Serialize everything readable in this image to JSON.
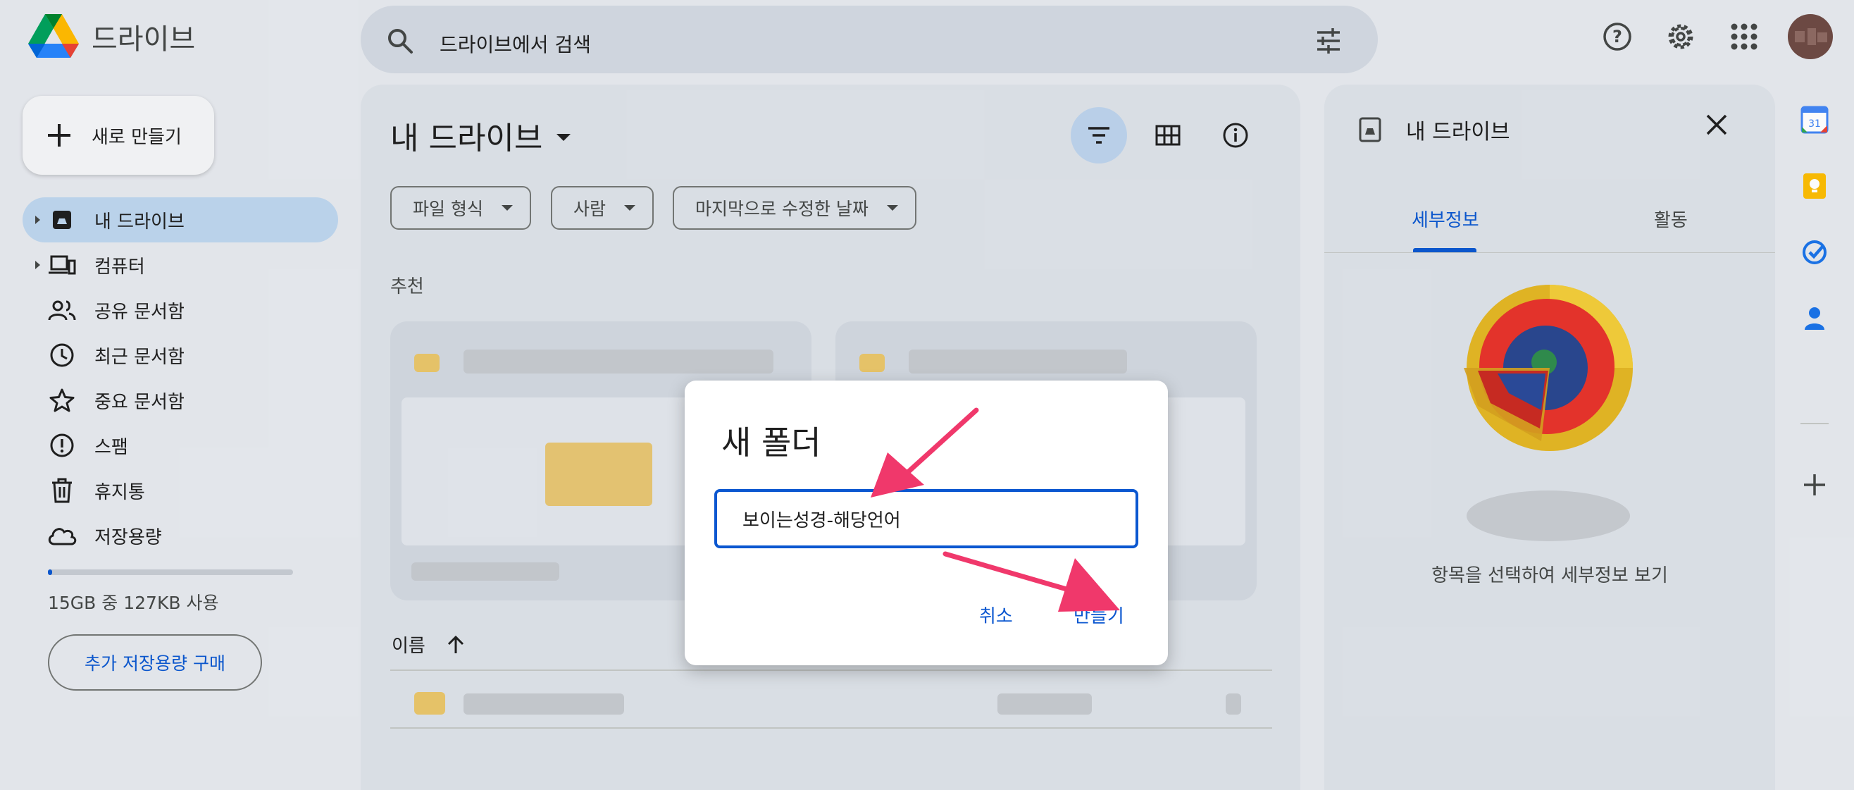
{
  "app": {
    "name": "드라이브"
  },
  "search": {
    "placeholder": "드라이브에서 검색"
  },
  "new_button": {
    "label": "새로 만들기"
  },
  "sidebar": {
    "items": [
      {
        "label": "내 드라이브",
        "icon": "drive-icon",
        "active": true,
        "expandable": true
      },
      {
        "label": "컴퓨터",
        "icon": "computer-icon",
        "active": false,
        "expandable": true
      },
      {
        "label": "공유 문서함",
        "icon": "people-icon",
        "active": false
      },
      {
        "label": "최근 문서함",
        "icon": "clock-icon",
        "active": false
      },
      {
        "label": "중요 문서함",
        "icon": "star-icon",
        "active": false
      },
      {
        "label": "스팸",
        "icon": "spam-icon",
        "active": false
      },
      {
        "label": "휴지통",
        "icon": "trash-icon",
        "active": false
      },
      {
        "label": "저장용량",
        "icon": "cloud-icon",
        "active": false
      }
    ],
    "storage_text": "15GB 중 127KB 사용",
    "buy_storage": "추가 저장용량 구매"
  },
  "main": {
    "title": "내 드라이브",
    "filters": [
      "파일 형식",
      "사람",
      "마지막으로 수정한 날짜"
    ],
    "suggested_label": "추천",
    "column_name": "이름"
  },
  "details": {
    "title": "내 드라이브",
    "tabs": [
      "세부정보",
      "활동"
    ],
    "empty_text": "항목을 선택하여 세부정보 보기"
  },
  "dialog": {
    "title": "새 폴더",
    "input_value": "보이는성경-해당언어",
    "cancel": "취소",
    "create": "만들기"
  },
  "colors": {
    "accent": "#0b57d0",
    "active_nav": "#bdd6ee",
    "annotation_arrow": "#f0386b"
  }
}
